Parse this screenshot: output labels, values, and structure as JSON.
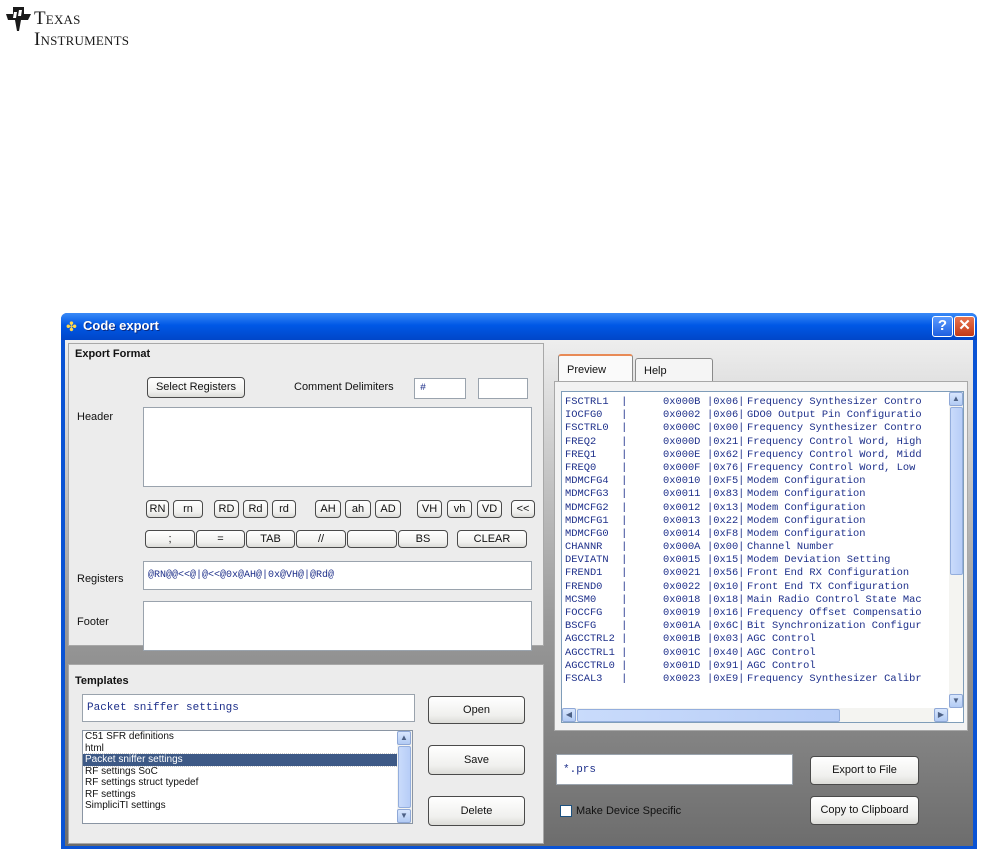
{
  "logo": {
    "line1": "Texas",
    "line2": "Instruments"
  },
  "window": {
    "title": "Code export",
    "help_label": "?",
    "close_label": "✕"
  },
  "export_format": {
    "title": "Export Format",
    "select_registers_label": "Select Registers",
    "comment_delimiters_label": "Comment Delimiters",
    "comment_delim_1": "#",
    "comment_delim_2": "",
    "header_label": "Header",
    "header_value": "",
    "token_buttons_row1": [
      "RN",
      "rn",
      "RD",
      "Rd",
      "rd",
      "AH",
      "ah",
      "AD",
      "VH",
      "vh",
      "VD",
      "<<"
    ],
    "token_buttons_row2": [
      ";",
      "=",
      "TAB",
      "//",
      "",
      "BS",
      "CLEAR"
    ],
    "registers_label": "Registers",
    "registers_value": "@RN@@<<@|@<<@0x@AH@|0x@VH@|@Rd@",
    "footer_label": "Footer",
    "footer_value": ""
  },
  "templates": {
    "title": "Templates",
    "selected_value": "Packet sniffer settings",
    "open_label": "Open",
    "save_label": "Save",
    "delete_label": "Delete",
    "items": [
      "C51 SFR definitions",
      "html",
      "Packet sniffer settings",
      "RF settings SoC",
      "RF settings struct typedef",
      "RF settings",
      "SimpliciTI settings"
    ],
    "selected_index": 2
  },
  "tabs": [
    {
      "label": "Preview",
      "active": true
    },
    {
      "label": "Help",
      "active": false
    }
  ],
  "preview_rows": [
    {
      "name": "FSCTRL1  |",
      "addr": "0x000B",
      "val": "|0x06|",
      "desc": "Frequency Synthesizer Contro"
    },
    {
      "name": "IOCFG0   |",
      "addr": "0x0002",
      "val": "|0x06|",
      "desc": "GDO0 Output Pin Configuratio"
    },
    {
      "name": "FSCTRL0  |",
      "addr": "0x000C",
      "val": "|0x00|",
      "desc": "Frequency Synthesizer Contro"
    },
    {
      "name": "FREQ2    |",
      "addr": "0x000D",
      "val": "|0x21|",
      "desc": "Frequency Control Word, High"
    },
    {
      "name": "FREQ1    |",
      "addr": "0x000E",
      "val": "|0x62|",
      "desc": "Frequency Control Word, Midd"
    },
    {
      "name": "FREQ0    |",
      "addr": "0x000F",
      "val": "|0x76|",
      "desc": "Frequency Control Word, Low"
    },
    {
      "name": "MDMCFG4  |",
      "addr": "0x0010",
      "val": "|0xF5|",
      "desc": "Modem Configuration"
    },
    {
      "name": "MDMCFG3  |",
      "addr": "0x0011",
      "val": "|0x83|",
      "desc": "Modem Configuration"
    },
    {
      "name": "MDMCFG2  |",
      "addr": "0x0012",
      "val": "|0x13|",
      "desc": "Modem Configuration"
    },
    {
      "name": "MDMCFG1  |",
      "addr": "0x0013",
      "val": "|0x22|",
      "desc": "Modem Configuration"
    },
    {
      "name": "MDMCFG0  |",
      "addr": "0x0014",
      "val": "|0xF8|",
      "desc": "Modem Configuration"
    },
    {
      "name": "CHANNR   |",
      "addr": "0x000A",
      "val": "|0x00|",
      "desc": "Channel Number"
    },
    {
      "name": "DEVIATN  |",
      "addr": "0x0015",
      "val": "|0x15|",
      "desc": "Modem Deviation Setting"
    },
    {
      "name": "FREND1   |",
      "addr": "0x0021",
      "val": "|0x56|",
      "desc": "Front End RX Configuration"
    },
    {
      "name": "FREND0   |",
      "addr": "0x0022",
      "val": "|0x10|",
      "desc": "Front End TX Configuration"
    },
    {
      "name": "MCSM0    |",
      "addr": "0x0018",
      "val": "|0x18|",
      "desc": "Main Radio Control State Mac"
    },
    {
      "name": "FOCCFG   |",
      "addr": "0x0019",
      "val": "|0x16|",
      "desc": "Frequency Offset Compensatio"
    },
    {
      "name": "BSCFG    |",
      "addr": "0x001A",
      "val": "|0x6C|",
      "desc": "Bit Synchronization Configur"
    },
    {
      "name": "AGCCTRL2 |",
      "addr": "0x001B",
      "val": "|0x03|",
      "desc": "AGC Control"
    },
    {
      "name": "AGCCTRL1 |",
      "addr": "0x001C",
      "val": "|0x40|",
      "desc": "AGC Control"
    },
    {
      "name": "AGCCTRL0 |",
      "addr": "0x001D",
      "val": "|0x91|",
      "desc": "AGC Control"
    },
    {
      "name": "FSCAL3   |",
      "addr": "0x0023",
      "val": "|0xE9|",
      "desc": "Frequency Synthesizer Calibr"
    }
  ],
  "export": {
    "file_filter_value": "*.prs",
    "export_to_file_label": "Export to File",
    "copy_to_clipboard_label": "Copy to Clipboard",
    "make_device_specific_label": "Make Device Specific",
    "make_device_specific_checked": false
  },
  "icons": {
    "app": "ti-chip-icon",
    "scroll_up": "chevron-up-icon",
    "scroll_down": "chevron-down-icon",
    "scroll_left": "chevron-left-icon",
    "scroll_right": "chevron-right-icon"
  },
  "colors": {
    "titlebar": "#0058e6",
    "monospace_text": "#1d2f8a",
    "list_selection": "#3d5986",
    "active_tab_accent": "#e88a56"
  }
}
